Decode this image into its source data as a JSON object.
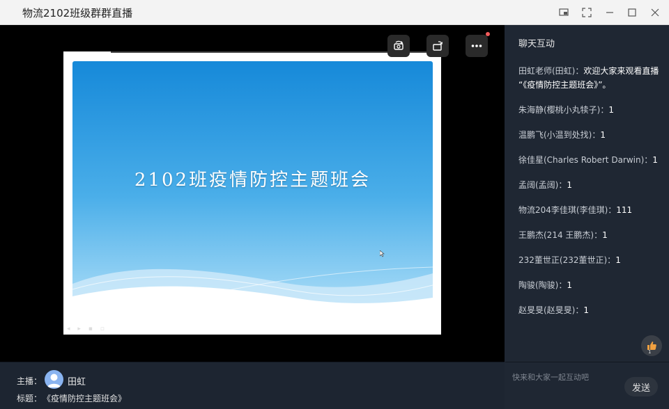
{
  "window": {
    "title": "物流2102班级群群直播"
  },
  "slide": {
    "title": "2102班疫情防控主题班会",
    "dots": "◂ ▸ ▪ ▫"
  },
  "chat": {
    "header": "聊天互动",
    "messages": [
      {
        "sender": "田虹老师(田虹)：",
        "content": "欢迎大家来观看直播 “《疫情防控主题班会》”。"
      },
      {
        "sender": "朱海静(樱桃小丸犊子)：",
        "content": "1"
      },
      {
        "sender": "温鹏飞(小温到处找)：",
        "content": "1"
      },
      {
        "sender": "徐佳星(Charles Robert Darwin)：",
        "content": "1"
      },
      {
        "sender": "孟阔(孟阔)：",
        "content": "1"
      },
      {
        "sender": "物流204李佳琪(李佳琪)：",
        "content": "111"
      },
      {
        "sender": "王鹏杰(214 王鹏杰)：",
        "content": "1"
      },
      {
        "sender": "232董世正(232董世正)：",
        "content": "1"
      },
      {
        "sender": "陶骏(陶骏)：",
        "content": "1"
      },
      {
        "sender": "赵旻旻(赵旻旻)：",
        "content": "1"
      }
    ],
    "like_count": "1",
    "input_placeholder": "快来和大家一起互动吧",
    "send_label": "发送"
  },
  "info": {
    "host_label": "主播：",
    "host_name": "田虹",
    "topic_label": "标题：",
    "topic_value": "《疫情防控主题班会》"
  },
  "colors": {
    "accent": "#2f93e0",
    "dark_bg": "#1f2733",
    "notice_dot": "#f25b5b"
  }
}
